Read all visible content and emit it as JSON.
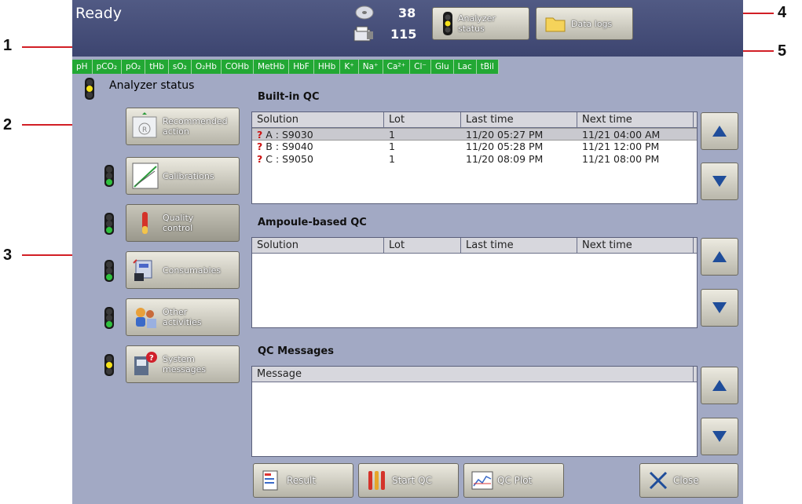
{
  "callouts": [
    "1",
    "2",
    "3",
    "4",
    "5"
  ],
  "header": {
    "status_title": "Ready",
    "counter_top": "38",
    "counter_bottom": "115",
    "analyzer_status_btn": "Analyzer status",
    "data_logs_btn": "Data logs"
  },
  "parameters": [
    "pH",
    "pCO₂",
    "pO₂",
    "tHb",
    "sO₂",
    "O₂Hb",
    "COHb",
    "MetHb",
    "HbF",
    "HHb",
    "K⁺",
    "Na⁺",
    "Ca²⁺",
    "Cl⁻",
    "Glu",
    "Lac",
    "tBil"
  ],
  "sidebar": {
    "title": "Analyzer status",
    "recommended_action": "Recommended action",
    "calibrations": "Calibrations",
    "quality_control": "Quality control",
    "consumables": "Consumables",
    "other_activities": "Other activities",
    "system_messages": "System messages"
  },
  "builtin_qc": {
    "title": "Built-in QC",
    "columns": [
      "Solution",
      "Lot",
      "Last time",
      "Next time"
    ],
    "rows": [
      {
        "solution": "A : S9030",
        "lot": "1",
        "last": "11/20 05:27 PM",
        "next": "11/21 04:00 AM"
      },
      {
        "solution": "B : S9040",
        "lot": "1",
        "last": "11/20 05:28 PM",
        "next": "11/21 12:00 PM"
      },
      {
        "solution": "C : S9050",
        "lot": "1",
        "last": "11/20 08:09 PM",
        "next": "11/21 08:00 PM"
      }
    ]
  },
  "ampoule_qc": {
    "title": "Ampoule-based QC",
    "columns": [
      "Solution",
      "Lot",
      "Last time",
      "Next time"
    ]
  },
  "qc_messages": {
    "title": "QC Messages",
    "column": "Message"
  },
  "footer": {
    "result": "Result",
    "start_qc": "Start QC",
    "qc_plot": "QC Plot",
    "close": "Close"
  },
  "colors": {
    "screen_bg": "#a2a9c4",
    "header_bg": "#454d78",
    "param_green": "#22a834",
    "callout_red": "#d21f26"
  }
}
